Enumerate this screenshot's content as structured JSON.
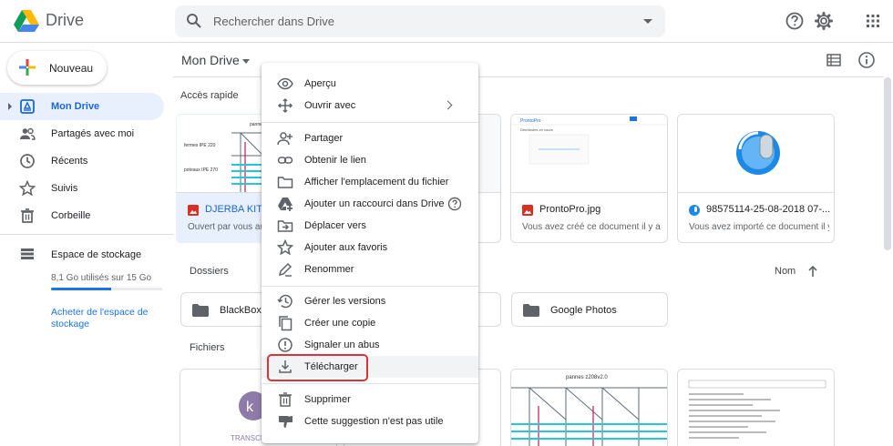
{
  "app": {
    "name": "Drive"
  },
  "search": {
    "placeholder": "Rechercher dans Drive"
  },
  "header_icons": [
    "help-icon",
    "settings-icon",
    "apps-grid-icon"
  ],
  "sidebar": {
    "new_label": "Nouveau",
    "items": [
      {
        "label": "Mon Drive",
        "icon": "my-drive-icon",
        "active": true
      },
      {
        "label": "Partagés avec moi",
        "icon": "shared-icon"
      },
      {
        "label": "Récents",
        "icon": "clock-icon"
      },
      {
        "label": "Suivis",
        "icon": "star-icon"
      },
      {
        "label": "Corbeille",
        "icon": "trash-icon"
      }
    ],
    "storage": {
      "label": "Espace de stockage",
      "used_text": "8,1 Go utilisés sur 15 Go",
      "fraction": 0.54,
      "buy_label": "Acheter de l'espace de stockage"
    }
  },
  "main": {
    "title": "Mon Drive",
    "quick_access_label": "Accès rapide",
    "folders_label": "Dossiers",
    "files_label": "Fichiers",
    "sort_label": "Nom",
    "quick_access": [
      {
        "name": "DJERBA KIT.jpg",
        "desc": "Ouvert par vous aujourd'hui"
      },
      {
        "name": "",
        "desc": ""
      },
      {
        "name": "ProntoPro.jpg",
        "desc": "Vous avez créé ce document il y a ..."
      },
      {
        "name": "98575114-25-08-2018 07-...",
        "desc": "Vous avez importé ce document il y..."
      }
    ],
    "folders": [
      {
        "name": "BlackBox"
      },
      {
        "name": ""
      },
      {
        "name": "Google Photos"
      }
    ],
    "thumb_texts": {
      "pannes_label": "pannes z209x2.0",
      "pannes_small": "pannes z208v2.0",
      "fermes_label": "fermes IPE 220",
      "poteaux_label": "poteaux IPE 270",
      "pronto_brand": "ProntoPro",
      "pronto_req": "Demandes en cours",
      "transcr": "TRANSCR"
    }
  },
  "context_menu": {
    "items": [
      {
        "label": "Aperçu",
        "icon": "eye-icon"
      },
      {
        "label": "Ouvrir avec",
        "icon": "move-arrows-icon",
        "submenu": true
      },
      {
        "label": "Partager",
        "icon": "add-person-icon"
      },
      {
        "label": "Obtenir le lien",
        "icon": "link-icon"
      },
      {
        "label": "Afficher l'emplacement du fichier",
        "icon": "folder-icon"
      },
      {
        "label": "Ajouter un raccourci dans Drive",
        "icon": "drive-shortcut-icon",
        "help": true
      },
      {
        "label": "Déplacer vers",
        "icon": "move-folder-icon"
      },
      {
        "label": "Ajouter aux favoris",
        "icon": "star-icon"
      },
      {
        "label": "Renommer",
        "icon": "pencil-icon"
      },
      {
        "label": "Gérer les versions",
        "icon": "history-icon"
      },
      {
        "label": "Créer une copie",
        "icon": "copy-icon"
      },
      {
        "label": "Signaler un abus",
        "icon": "alert-circle-icon"
      },
      {
        "label": "Télécharger",
        "icon": "download-icon",
        "highlighted": true
      },
      {
        "label": "Supprimer",
        "icon": "trash-icon"
      },
      {
        "label": "Cette suggestion n'est pas utile",
        "icon": "thumbs-down-icon"
      }
    ]
  },
  "colors": {
    "accent_blue": "#1a73e8",
    "active_bg": "#e8f0fe",
    "highlight_box": "#e0303a",
    "folder_gray": "#5f6368"
  }
}
